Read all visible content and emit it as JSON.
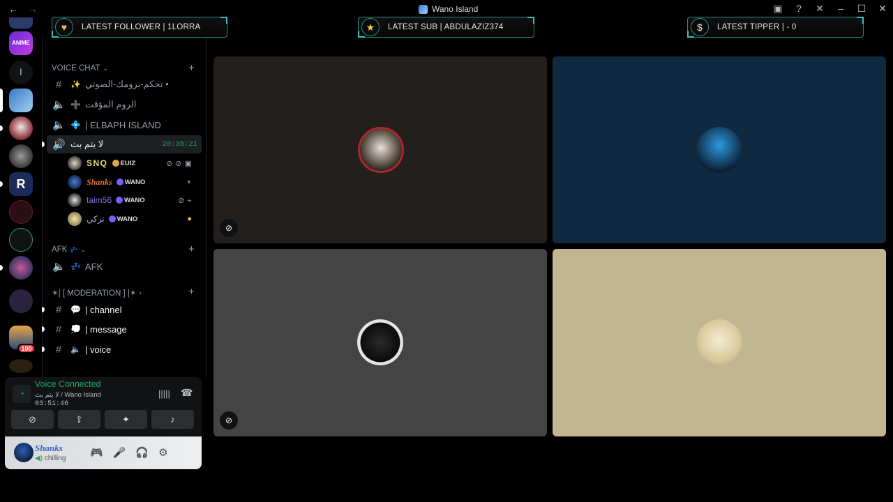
{
  "titlebar": {
    "title": "Wano Island",
    "nav_back": "←",
    "nav_forward": "→",
    "icons": [
      "inbox-icon",
      "help-icon",
      "tools-icon",
      "minimize-icon",
      "maximize-icon",
      "close-icon"
    ]
  },
  "banners": {
    "follower": "LATEST FOLLOWER | 1LORRA",
    "sub": "LATEST SUB | ABDULAZIZ374",
    "tipper": "LATEST TIPPER |  - 0"
  },
  "servers": {
    "badge_count": "100",
    "anime_label": "ANIME"
  },
  "sidebar": {
    "voice_chat_category": "VOICE CHAT",
    "channels_voice": [
      {
        "label": "تحكم-برومك-الصوتي •",
        "emoji": "✨"
      },
      {
        "label": "الروم المؤقت",
        "emoji": "➕"
      },
      {
        "label": "| ELBAPH ISLAND",
        "emoji": "💠"
      }
    ],
    "active_channel": {
      "label": "لا يتم بث",
      "time": "20:35:21"
    },
    "users": [
      {
        "name": "SNQ",
        "tag": "EUIZ",
        "color": "#e8d66a"
      },
      {
        "name": "Shanks",
        "tag": "WANO",
        "color": "#e36f3a"
      },
      {
        "name": "taim56",
        "tag": "WANO",
        "color": "#8b6be8"
      },
      {
        "name": "ترکي",
        "tag": "WANO",
        "color": "#c89de3"
      }
    ],
    "afk_category": "AFK",
    "afk_channel": "AFK",
    "moderation_category": "✶| [ MODERATION ] |✶",
    "channels_text": [
      {
        "label": "| channel",
        "emoji": "💬"
      },
      {
        "label": "| message",
        "emoji": "💭"
      },
      {
        "label": "| voice",
        "emoji": "🔈"
      }
    ]
  },
  "voice_panel": {
    "status": "Voice Connected",
    "room": "لا يتم بث / Wano Island",
    "elapsed": "03:51:46"
  },
  "user_bar": {
    "username": "Shanks",
    "status": "chilling"
  },
  "colors": {
    "tile_1": "#221f1d",
    "tile_2": "#0f2a40",
    "tile_3": "#444444",
    "tile_4": "#c2b592",
    "online": "#23a55a",
    "accent_teal": "#2b8a8a"
  }
}
